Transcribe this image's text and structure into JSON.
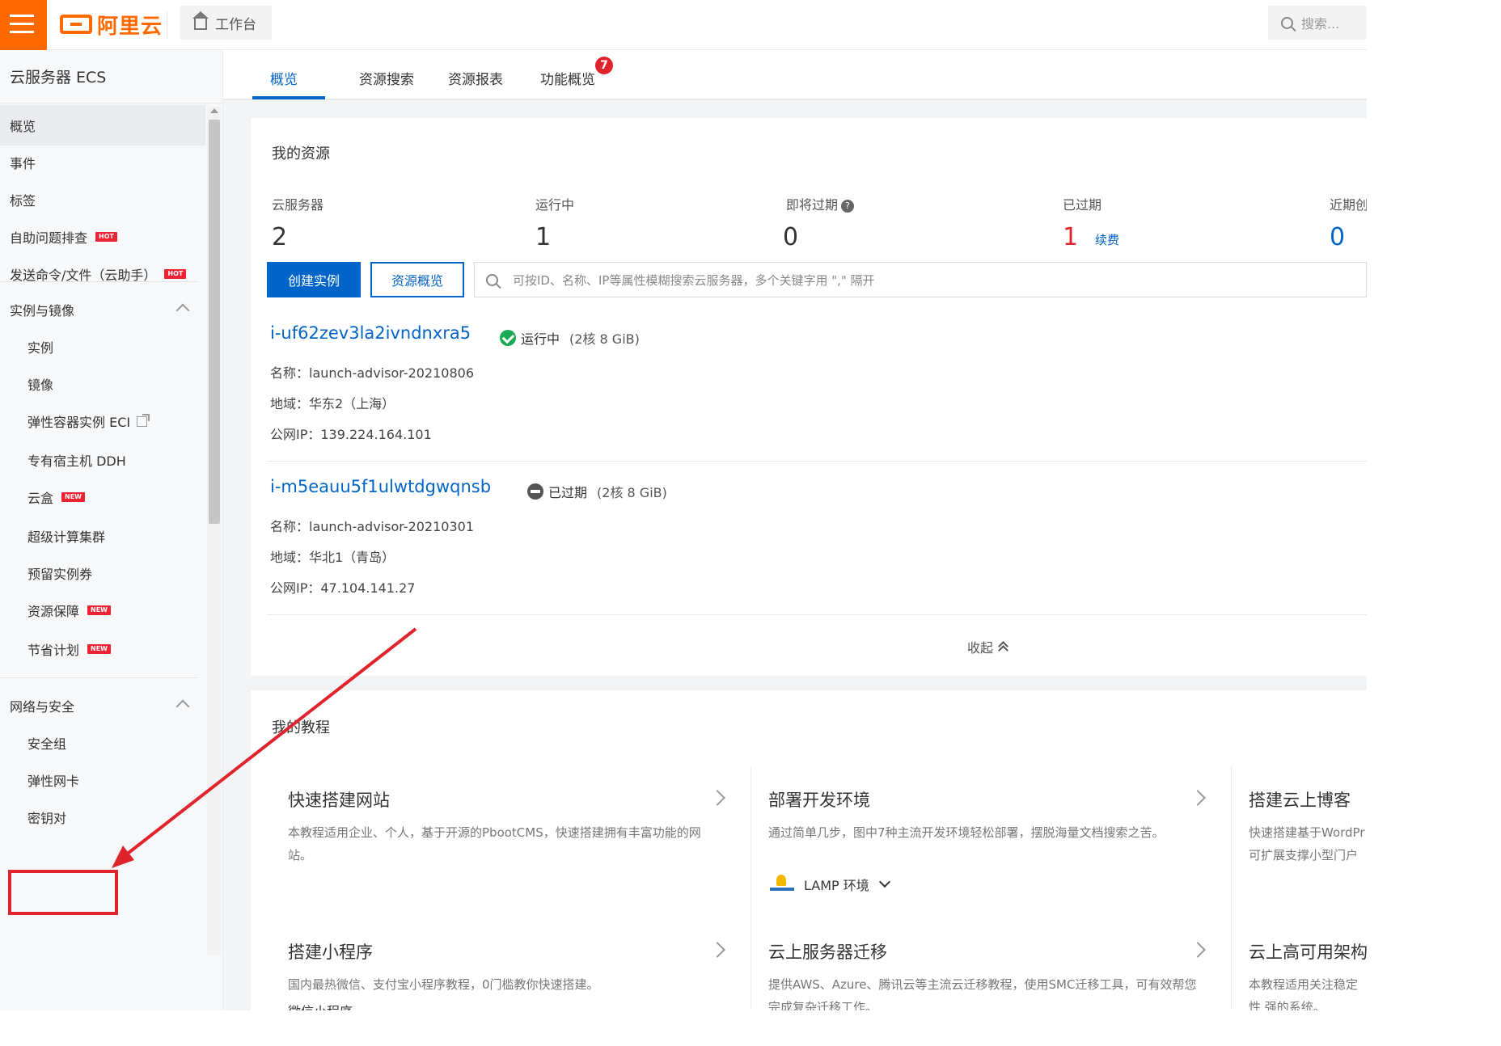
{
  "topbar": {
    "logo_text": "阿里云",
    "workbench_label": "工作台",
    "search_placeholder": "搜索..."
  },
  "sidebar": {
    "title": "云服务器 ECS",
    "items": [
      {
        "label": "概览"
      },
      {
        "label": "事件"
      },
      {
        "label": "标签"
      },
      {
        "label": "自助问题排查",
        "badge": "HOT"
      },
      {
        "label": "发送命令/文件（云助手）",
        "badge": "HOT"
      }
    ],
    "group_instances": {
      "label": "实例与镜像",
      "items": [
        {
          "label": "实例"
        },
        {
          "label": "镜像"
        },
        {
          "label": "弹性容器实例 ECI"
        },
        {
          "label": "专有宿主机 DDH"
        },
        {
          "label": "云盒",
          "badge": "NEW"
        },
        {
          "label": "超级计算集群"
        },
        {
          "label": "预留实例券"
        },
        {
          "label": "资源保障",
          "badge": "NEW"
        },
        {
          "label": "节省计划",
          "badge": "NEW"
        }
      ]
    },
    "group_network": {
      "label": "网络与安全",
      "items": [
        {
          "label": "安全组"
        },
        {
          "label": "弹性网卡"
        },
        {
          "label": "密钥对"
        }
      ]
    }
  },
  "tabs": [
    {
      "label": "概览"
    },
    {
      "label": "资源搜索"
    },
    {
      "label": "资源报表"
    },
    {
      "label": "功能概览"
    }
  ],
  "tab_badge": "7",
  "resources": {
    "title": "我的资源",
    "stats": [
      {
        "label": "云服务器",
        "value": "2"
      },
      {
        "label": "运行中",
        "value": "1"
      },
      {
        "label": "即将过期",
        "value": "0"
      },
      {
        "label": "已过期",
        "value": "1"
      },
      {
        "label": "近期创建",
        "value": "0"
      }
    ],
    "renew_label": "续费",
    "create_button": "创建实例",
    "overview_button": "资源概览",
    "search_placeholder": "可按ID、名称、IP等属性模糊搜索云服务器，多个关键字用 \",\" 隔开",
    "instances": [
      {
        "id": "i-uf62zev3la2ivndnxra5",
        "status": "运行中",
        "spec": "(2核 8 GiB)",
        "name": "名称：launch-advisor-20210806",
        "region": "地域：华东2（上海）",
        "ip": "公网IP：139.224.164.101"
      },
      {
        "id": "i-m5eauu5f1ulwtdgwqnsb",
        "status": "已过期",
        "spec": "(2核 8 GiB)",
        "name": "名称：launch-advisor-20210301",
        "region": "地域：华北1（青岛）",
        "ip": "公网IP：47.104.141.27"
      }
    ],
    "collapse_label": "收起"
  },
  "tutorials": {
    "title": "我的教程",
    "items": [
      {
        "title": "快速搭建网站",
        "desc": "本教程适用企业、个人，基于开源的PbootCMS，快速搭建拥有丰富功能的网站。"
      },
      {
        "title": "部署开发环境",
        "desc": "通过简单几步，图中7种主流开发环境轻松部署，摆脱海量文档搜索之苦。",
        "env": "LAMP 环境"
      },
      {
        "title": "搭建云上博客",
        "desc": "快速搭建基于WordPr 可扩展支撑小型门户网"
      },
      {
        "title": "搭建小程序",
        "desc": "国内最热微信、支付宝小程序教程，0门槛教你快速搭建。",
        "env": "微信小程序"
      },
      {
        "title": "云上服务器迁移",
        "desc": "提供AWS、Azure、腾讯云等主流云迁移教程，使用SMC迁移工具，可有效帮您完成复杂迁移工作。"
      },
      {
        "title": "云上高可用架构",
        "desc": "本教程适用关注稳定性 强的系统。"
      }
    ]
  },
  "colors": {
    "brand": "#ff6a00",
    "primary": "#0064c8",
    "danger": "#e0242e",
    "success": "#1aaa55"
  }
}
